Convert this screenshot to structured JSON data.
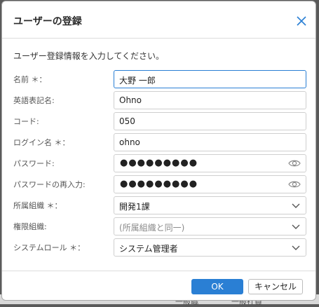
{
  "dialog": {
    "title": "ユーザーの登録",
    "intro": "ユーザー登録情報を入力してください。"
  },
  "fields": {
    "name": {
      "label": "名前 ＊：",
      "value": "大野 一郎"
    },
    "english_name": {
      "label": "英語表記名:",
      "value": "Ohno"
    },
    "code": {
      "label": "コード:",
      "value": "050"
    },
    "login_name": {
      "label": "ログイン名 ＊：",
      "value": "ohno"
    },
    "password": {
      "label": "パスワード:",
      "value": "●●●●●●●●●"
    },
    "password_confirm": {
      "label": "パスワードの再入力:",
      "value": "●●●●●●●●●"
    },
    "organization": {
      "label": "所属組織 ＊：",
      "value": "開発1課"
    },
    "permission_org": {
      "label": "権限組織:",
      "placeholder": "(所属組織と同一)"
    },
    "system_role": {
      "label": "システムロール ＊：",
      "value": "システム管理者"
    }
  },
  "buttons": {
    "ok": "OK",
    "cancel": "キャンセル"
  },
  "background": {
    "left_text": "",
    "mid_text": "一般職",
    "right_text": "一般社員"
  },
  "colors": {
    "accent": "#2a7fd4",
    "border": "#cfcfcf"
  }
}
